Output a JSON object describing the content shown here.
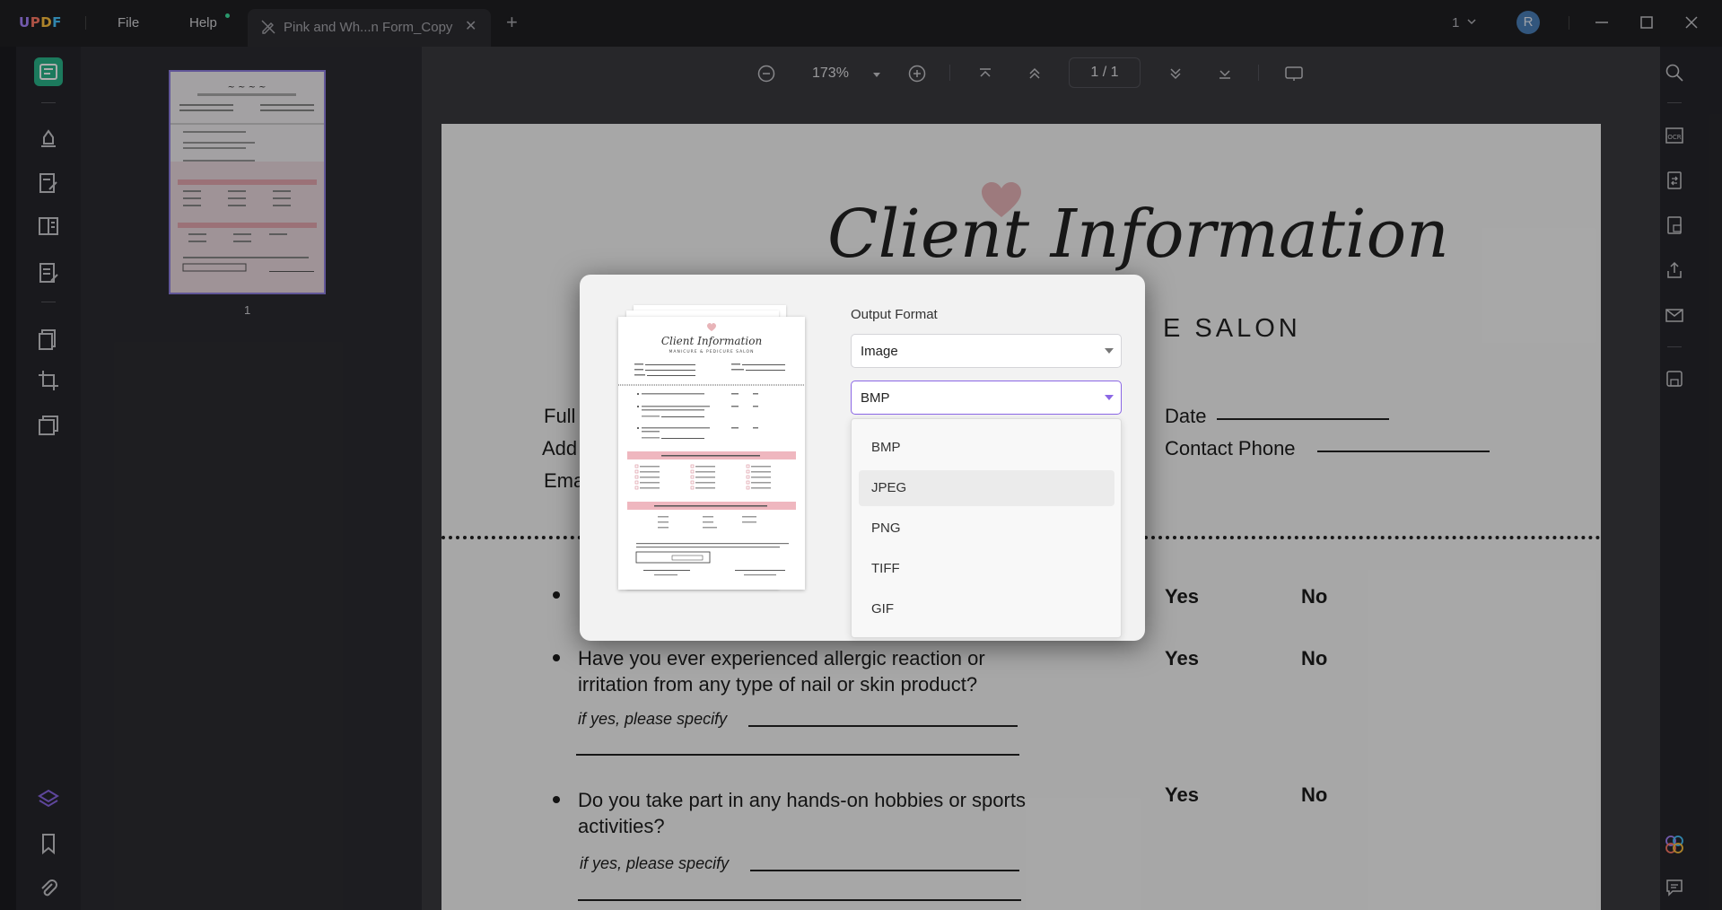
{
  "app": {
    "logo": {
      "u": "U",
      "p": "P",
      "d": "D",
      "f": "F"
    },
    "menu": {
      "file": "File",
      "help": "Help"
    },
    "tab": {
      "title": "Pink and Wh...n Form_Copy",
      "close": "✕"
    },
    "new_tab": "+",
    "window_count": "1",
    "avatar_initial": "R"
  },
  "toolbar": {
    "zoom": "173%",
    "page_indicator": "1  /  1"
  },
  "thumbnails": [
    {
      "page_label": "1"
    }
  ],
  "document": {
    "script_title": "Client Information",
    "subtitle_visible": "E SALON",
    "fields": {
      "full": "Full",
      "add": "Add",
      "ema": "Ema",
      "date": "Date",
      "contact_phone": "Contact Phone"
    },
    "questions": [
      {
        "line1": "",
        "yes": "Yes",
        "no": "No"
      },
      {
        "line1": "Have you ever experienced allergic reaction or",
        "line2": "irritation from any type of nail or skin product?",
        "specify": "if yes, please specify",
        "yes": "Yes",
        "no": "No"
      },
      {
        "line1": "Do you take part in any hands-on hobbies or sports",
        "line2": "activities?",
        "specify": "if yes, please specify",
        "yes": "Yes",
        "no": "No"
      }
    ]
  },
  "dialog": {
    "output_format_label": "Output Format",
    "format_select": "Image",
    "image_type_select": "BMP",
    "options": [
      "BMP",
      "JPEG",
      "PNG",
      "TIFF",
      "GIF"
    ],
    "hovered_option": "JPEG",
    "preview": {
      "title": "Client Information",
      "subtitle": "MANICURE & PEDICURE SALON"
    }
  },
  "colors": {
    "accent": "#8b67e5",
    "rail_active": "#2ab489",
    "heart": "#e8b4b8",
    "pink_band": "#efb7bf"
  }
}
